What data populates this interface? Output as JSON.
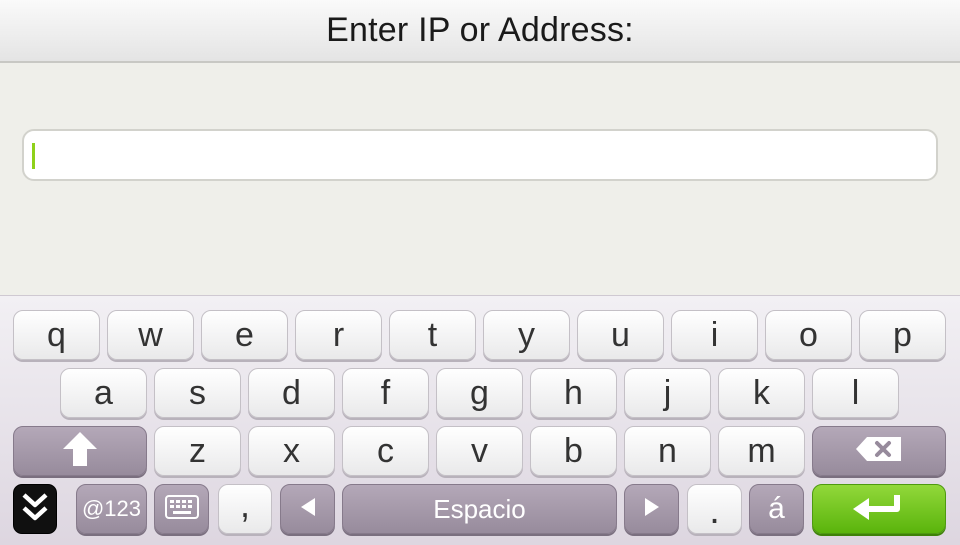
{
  "header": {
    "title": "Enter IP or Address:"
  },
  "input": {
    "value": ""
  },
  "keyboard": {
    "row1": [
      "q",
      "w",
      "e",
      "r",
      "t",
      "y",
      "u",
      "i",
      "o",
      "p"
    ],
    "row2": [
      "a",
      "s",
      "d",
      "f",
      "g",
      "h",
      "j",
      "k",
      "l"
    ],
    "row3": [
      "z",
      "x",
      "c",
      "v",
      "b",
      "n",
      "m"
    ],
    "bottom": {
      "symbols_label": "@123",
      "comma_label": ",",
      "space_label": "Espacio",
      "period_label": ".",
      "accent_label": "á"
    }
  },
  "icons": {
    "shift": "shift-arrow-icon",
    "backspace": "backspace-icon",
    "close": "double-chevron-down-icon",
    "keyboard": "keyboard-icon",
    "left": "arrow-left-icon",
    "right": "arrow-right-icon",
    "enter": "enter-icon"
  },
  "colors": {
    "caret": "#8fd11a",
    "enter": "#6cc21a"
  }
}
